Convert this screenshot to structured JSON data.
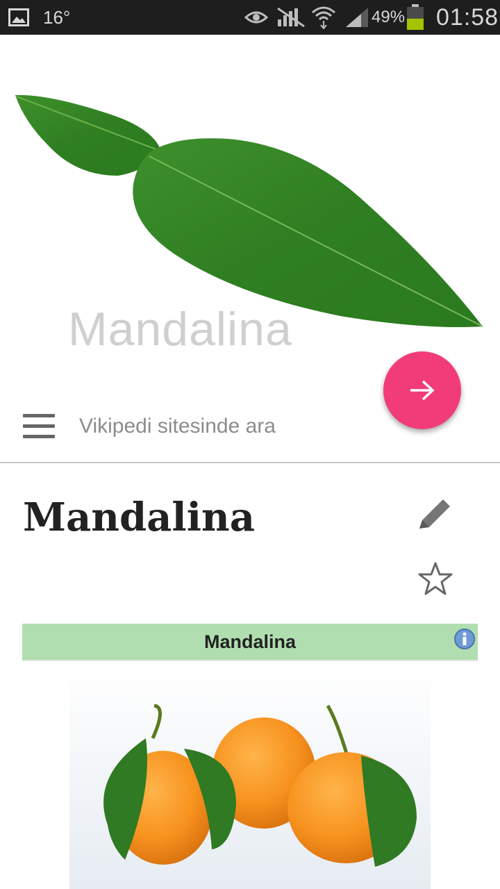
{
  "status_bar": {
    "temperature": "16°",
    "battery_percent": "49%",
    "battery_level": 0.49,
    "time": "01:58",
    "icons": [
      "gallery-icon",
      "eye-icon",
      "no-signal-icon",
      "wifi-icon",
      "cell-signal-icon",
      "battery-icon"
    ]
  },
  "header": {
    "lead_title": "Mandalina",
    "search_placeholder": "Vikipedi sitesinde ara",
    "fab_icon": "arrow-right-icon",
    "fab_color": "#f23c7a"
  },
  "article": {
    "title": "Mandalina",
    "actions": [
      "edit-icon",
      "star-icon"
    ],
    "infobox": {
      "header": "Mandalina",
      "header_color": "#b0deb0"
    }
  }
}
